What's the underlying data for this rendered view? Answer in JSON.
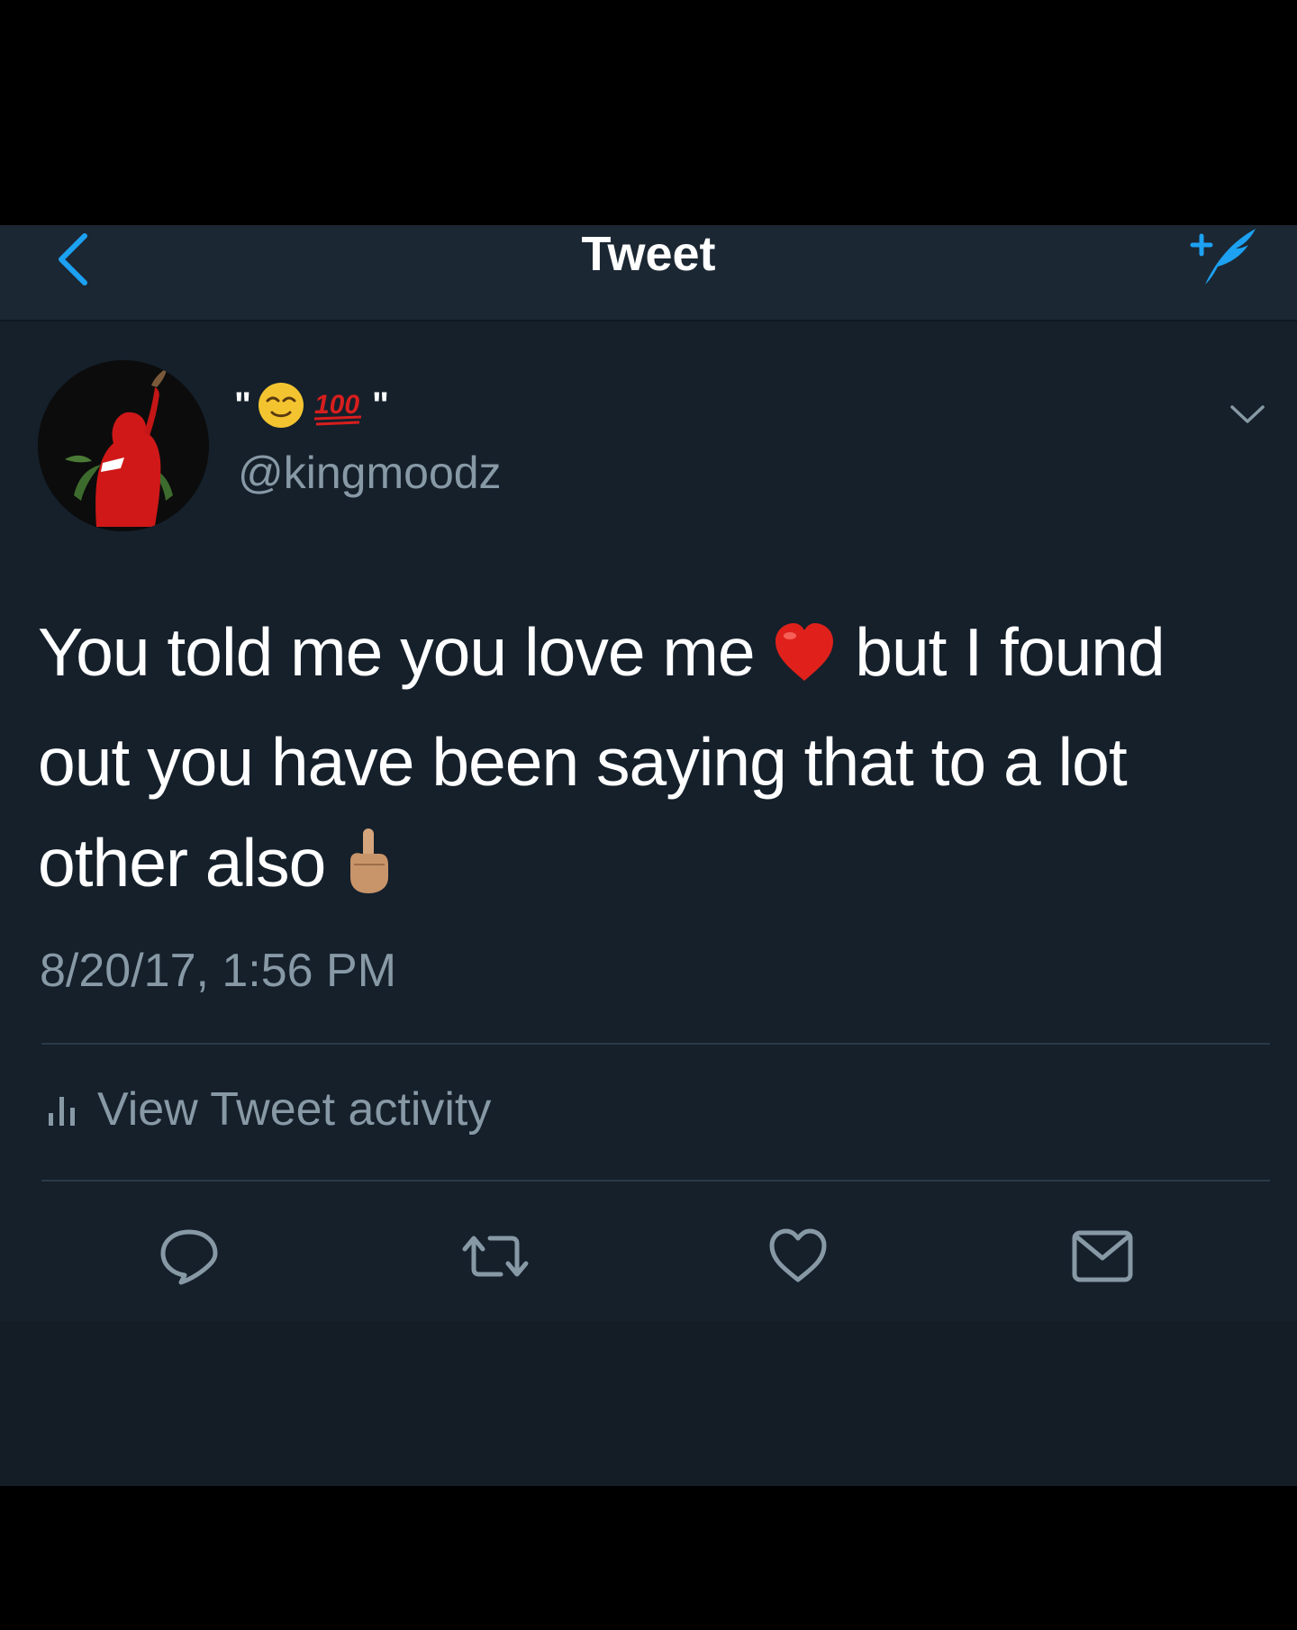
{
  "nav": {
    "title": "Tweet",
    "back_icon": "chevron-left-icon",
    "compose_icon": "compose-tweet-icon",
    "accent_color": "#1da1f2"
  },
  "tweet": {
    "display_name": {
      "prefix": "\"",
      "emojis": [
        "relieved-face-emoji",
        "hundred-points-emoji"
      ],
      "suffix": "\""
    },
    "handle": "@kingmoodz",
    "text_line1_a": "You told me you love me",
    "text_line1_b": "but I found",
    "text_line2": "out you have been saying that to a lot",
    "text_line3": "other also",
    "inline_emojis": [
      "red-heart-emoji",
      "middle-finger-emoji"
    ],
    "timestamp": "8/20/17, 1:56 PM",
    "activity_label": "View Tweet activity"
  },
  "actions": [
    "reply-icon",
    "retweet-icon",
    "like-icon",
    "share-icon"
  ],
  "colors": {
    "background": "#15202b",
    "navbar": "#1b2733",
    "secondary_text": "#8899a6",
    "primary_text": "#ffffff"
  }
}
